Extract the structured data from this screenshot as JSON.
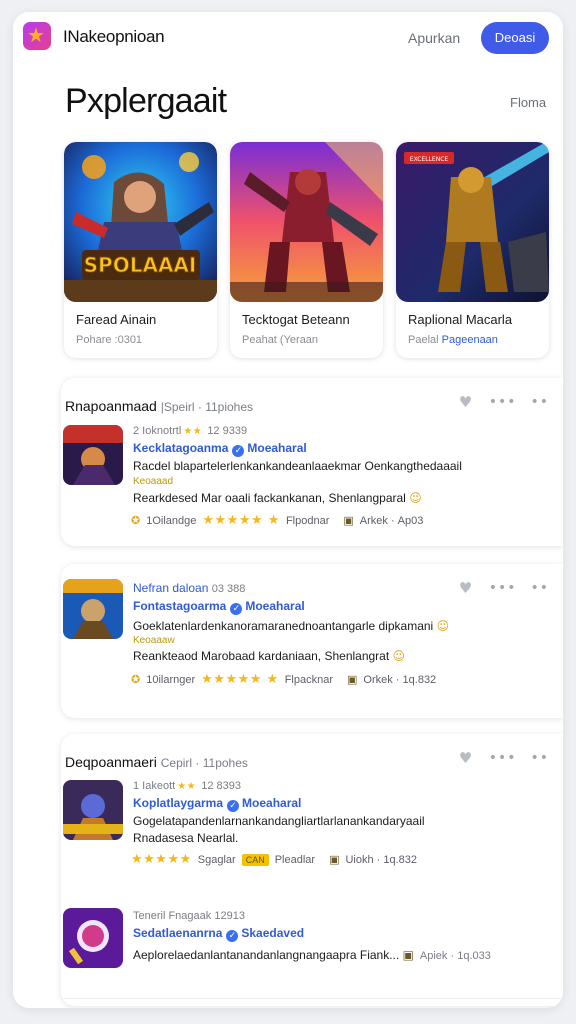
{
  "header": {
    "app_name": "INakeopnioan",
    "nav_link": "Apurkan",
    "primary_button": "Deoasi"
  },
  "page": {
    "title": "Pxplergaait",
    "title_link": "Floma"
  },
  "featured": [
    {
      "art_text": "SPOLAAAI",
      "name": "Faread Ainain",
      "sub": "Pohare :0301"
    },
    {
      "name": "Tecktogat Beteann",
      "sub": "Peahat (Yeraan"
    },
    {
      "art_badge": "EXCELLENCE",
      "name": "Raplional Macarla",
      "sub": "Paelal",
      "sub_accent": "Pageenaan"
    }
  ],
  "sections": [
    {
      "title": "Rnapoanmaad",
      "title_meta": "|Speirl · 11piohes",
      "rows": [
        {
          "meta": "2 Ioknotrtl",
          "meta_stars": "★★",
          "meta_code": "12 9339",
          "dev": "Kecklatagoanma",
          "dev_tag": "Moeaharal",
          "desc": "Racdel blapartelerlenkankandeanlaaekmar Oenkangthedaaail",
          "tag": "Keoaaad",
          "desc2": "Rearkdesed Mar oaali fackankanan, Shenlangparal",
          "desc2_emoji": "☺",
          "rating_label": "1Oilandge",
          "stars": "★★★★★ ★",
          "publisher": "Flpodnar",
          "size": "Arkek",
          "version": "Ap03"
        }
      ]
    },
    {
      "title": "",
      "rows": [
        {
          "meta_strong": "Nefran daloan",
          "meta_code": "03 388",
          "dev": "Fontastagoarma",
          "dev_tag": "Moeaharal",
          "desc": "Goeklatenlardenkanoramaranednoantangarle dipkamani",
          "desc_emoji": "☺",
          "tag": "Keoaaaw",
          "desc2": "Reankteaod Marobaad kardaniaan, Shenlangrat",
          "desc2_emoji": "☺",
          "rating_label": "10ilarnger",
          "stars": "★★★★★ ★",
          "publisher": "Flpacknar",
          "size": "Orkek",
          "version": "1q.832"
        }
      ]
    },
    {
      "title": "Deqpoanmaeri",
      "title_meta": "Cepirl · 11pohes",
      "rows": [
        {
          "meta": "1 Iakeott",
          "meta_stars": "★★",
          "meta_code": "12 8393",
          "dev": "Koplatlaygarma",
          "dev_tag": "Moeaharal",
          "desc": "Gogelatapandenlarnankandangliartlarlanankandaryaail",
          "desc_line2": "Rnadasesa Nearlal.",
          "stars": "★★★★★",
          "rating_label": "Sgaglar",
          "chip": "CAN",
          "publisher": "Pleadlar",
          "size": "Uiokh",
          "version": "1q.832"
        },
        {
          "meta": "Teneril Fnagaak",
          "meta_code": "12913",
          "dev": "Sedatlaenanrna",
          "dev_tag": "Skaedaved",
          "desc": "Aeplorelaedanlantanandanlangnangaapra Fiank...",
          "size": "Apiek",
          "version": "1q.033"
        }
      ]
    }
  ],
  "colors": {
    "accent": "#3f5be8",
    "link_blue": "#2f5bd6",
    "star": "#f5b81a",
    "card_bg": "#ffffff",
    "page_bg": "#eef0f3"
  },
  "icons": [
    "app-logo-star-icon",
    "heart-icon",
    "more-dots-icon",
    "verified-badge-icon",
    "coin-icon",
    "cube-icon",
    "smile-icon"
  ]
}
